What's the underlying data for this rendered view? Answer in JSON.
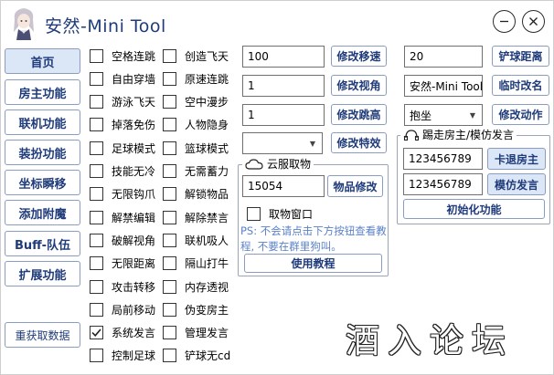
{
  "app": {
    "title": "安然-Mini Tool"
  },
  "nav": [
    {
      "label": "首页"
    },
    {
      "label": "房主功能"
    },
    {
      "label": "联机功能"
    },
    {
      "label": "装扮功能"
    },
    {
      "label": "坐标瞬移"
    },
    {
      "label": "添加附魔"
    },
    {
      "label": "Buff-队伍"
    },
    {
      "label": "扩展功能"
    }
  ],
  "refresh_label": "重获取数据",
  "checks_col1": [
    {
      "label": "空格连跳",
      "checked": false
    },
    {
      "label": "自由穿墙",
      "checked": false
    },
    {
      "label": "游泳飞天",
      "checked": false
    },
    {
      "label": "掉落免伤",
      "checked": false
    },
    {
      "label": "足球模式",
      "checked": false
    },
    {
      "label": "技能无冷",
      "checked": false
    },
    {
      "label": "无限钩爪",
      "checked": false
    },
    {
      "label": "解禁编辑",
      "checked": false
    },
    {
      "label": "破解视角",
      "checked": false
    },
    {
      "label": "无限距离",
      "checked": false
    },
    {
      "label": "攻击转移",
      "checked": false
    },
    {
      "label": "局前移动",
      "checked": false
    },
    {
      "label": "系统发言",
      "checked": true
    },
    {
      "label": "控制足球",
      "checked": false
    }
  ],
  "checks_col2": [
    {
      "label": "创造飞天",
      "checked": false
    },
    {
      "label": "原速连跳",
      "checked": false
    },
    {
      "label": "空中漫步",
      "checked": false
    },
    {
      "label": "人物隐身",
      "checked": false
    },
    {
      "label": "篮球模式",
      "checked": false
    },
    {
      "label": "无需蓄力",
      "checked": false
    },
    {
      "label": "解锁物品",
      "checked": false
    },
    {
      "label": "解除禁言",
      "checked": false
    },
    {
      "label": "联机吸人",
      "checked": false
    },
    {
      "label": "隔山打牛",
      "checked": false
    },
    {
      "label": "内存透视",
      "checked": false
    },
    {
      "label": "伪变房主",
      "checked": false
    },
    {
      "label": "管理发言",
      "checked": false
    },
    {
      "label": "铲球无cd",
      "checked": false
    }
  ],
  "speed": {
    "value": "100",
    "button": "修改移速"
  },
  "view": {
    "value": "1",
    "button": "修改视角"
  },
  "jump": {
    "value": "1",
    "button": "修改跳高"
  },
  "effect": {
    "value": "",
    "button": "修改特效"
  },
  "cloud": {
    "title": "云服取物",
    "item_value": "15054",
    "item_button": "物品修改",
    "window_label": "取物窗口",
    "window_checked": false,
    "note": "PS: 不会请点击下方按钮查看教程, 不要在群里狗叫。",
    "tutorial_button": "使用教程"
  },
  "shovel": {
    "value": "20",
    "button": "铲球距离"
  },
  "rename": {
    "value": "安然-Mini Tool",
    "button": "临时改名"
  },
  "action": {
    "value": "抱坐",
    "button": "修改动作"
  },
  "kick": {
    "title": "踢走房主/模仿发言",
    "id1": "123456789",
    "kick_button": "卡退房主",
    "id2": "123456789",
    "mimic_button": "模仿发言",
    "init_button": "初始化功能"
  },
  "watermark": "酒入论坛",
  "colors": {
    "accent": "#1f3b7a",
    "border": "#8a9cc0",
    "note": "#5a82c8",
    "selected": "#dbe7f7"
  }
}
